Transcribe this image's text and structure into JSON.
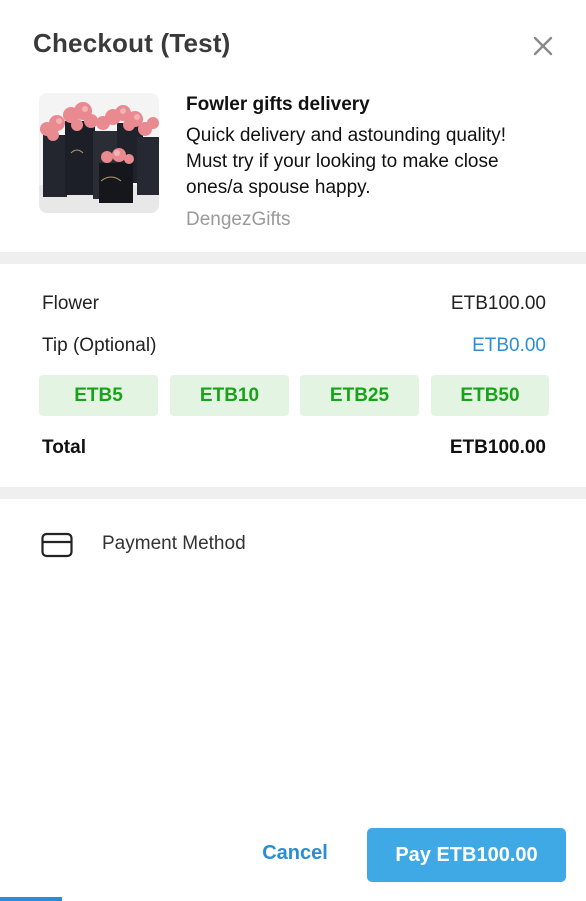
{
  "header": {
    "title": "Checkout (Test)",
    "close_icon": "close-icon"
  },
  "product": {
    "name": "Fowler gifts delivery",
    "description": "Quick delivery and astounding quality! Must try if your looking to make close ones/a spouse happy.",
    "shop": "DengezGifts"
  },
  "summary": {
    "item_label": "Flower",
    "item_price": "ETB100.00",
    "tip_label": "Tip (Optional)",
    "tip_value": "ETB0.00",
    "tip_options": [
      "ETB5",
      "ETB10",
      "ETB25",
      "ETB50"
    ],
    "total_label": "Total",
    "total_value": "ETB100.00"
  },
  "payment": {
    "label": "Payment Method",
    "icon": "credit-card-icon"
  },
  "actions": {
    "cancel_label": "Cancel",
    "pay_label": "Pay ETB100.00"
  },
  "colors": {
    "accent": "#3fa9e6",
    "link": "#2a8ed6",
    "tip_bg": "#e3f4e3",
    "tip_text": "#1aa31a",
    "muted": "#9a9a9a"
  }
}
